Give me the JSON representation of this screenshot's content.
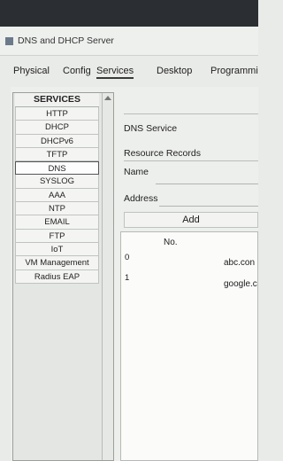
{
  "window": {
    "title": "DNS and DHCP Server"
  },
  "tabs": [
    {
      "label": "Physical"
    },
    {
      "label": "Config"
    },
    {
      "label": "Services"
    },
    {
      "label": "Desktop"
    },
    {
      "label": "Programmi"
    }
  ],
  "services": {
    "header": "SERVICES",
    "items": [
      "HTTP",
      "DHCP",
      "DHCPv6",
      "TFTP",
      "DNS",
      "SYSLOG",
      "AAA",
      "NTP",
      "EMAIL",
      "FTP",
      "IoT",
      "VM Management",
      "Radius EAP"
    ],
    "selected": "DNS"
  },
  "dns": {
    "service_label": "DNS Service",
    "records_label": "Resource Records",
    "name_label": "Name",
    "address_label": "Address",
    "add_label": "Add",
    "table": {
      "col_no": "No.",
      "rows": [
        {
          "no": "0",
          "name": "abc.con"
        },
        {
          "no": "1",
          "name": "google.c"
        }
      ]
    }
  }
}
